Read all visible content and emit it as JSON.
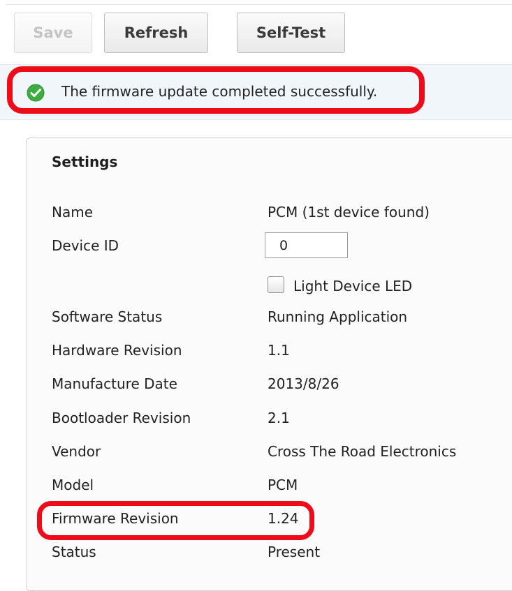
{
  "toolbar": {
    "save_label": "Save",
    "refresh_label": "Refresh",
    "selftest_label": "Self-Test"
  },
  "notification": {
    "icon": "check-circle-icon",
    "message": "The firmware update completed successfully."
  },
  "settings": {
    "title": "Settings",
    "name": {
      "label": "Name",
      "value": "PCM (1st device found)"
    },
    "device_id": {
      "label": "Device ID",
      "value": "0"
    },
    "light_led": {
      "label": "Light Device LED",
      "checked": false
    },
    "software_status": {
      "label": "Software Status",
      "value": "Running Application"
    },
    "hardware_revision": {
      "label": "Hardware Revision",
      "value": "1.1"
    },
    "manufacture_date": {
      "label": "Manufacture Date",
      "value": "2013/8/26"
    },
    "bootloader_revision": {
      "label": "Bootloader Revision",
      "value": "2.1"
    },
    "vendor": {
      "label": "Vendor",
      "value": "Cross The Road Electronics"
    },
    "model": {
      "label": "Model",
      "value": "PCM"
    },
    "firmware_revision": {
      "label": "Firmware Revision",
      "value": "1.24"
    },
    "status": {
      "label": "Status",
      "value": "Present"
    }
  },
  "colors": {
    "highlight": "#ee0c1b",
    "success": "#3cae3f",
    "notification_bg": "#f1f6fb"
  }
}
